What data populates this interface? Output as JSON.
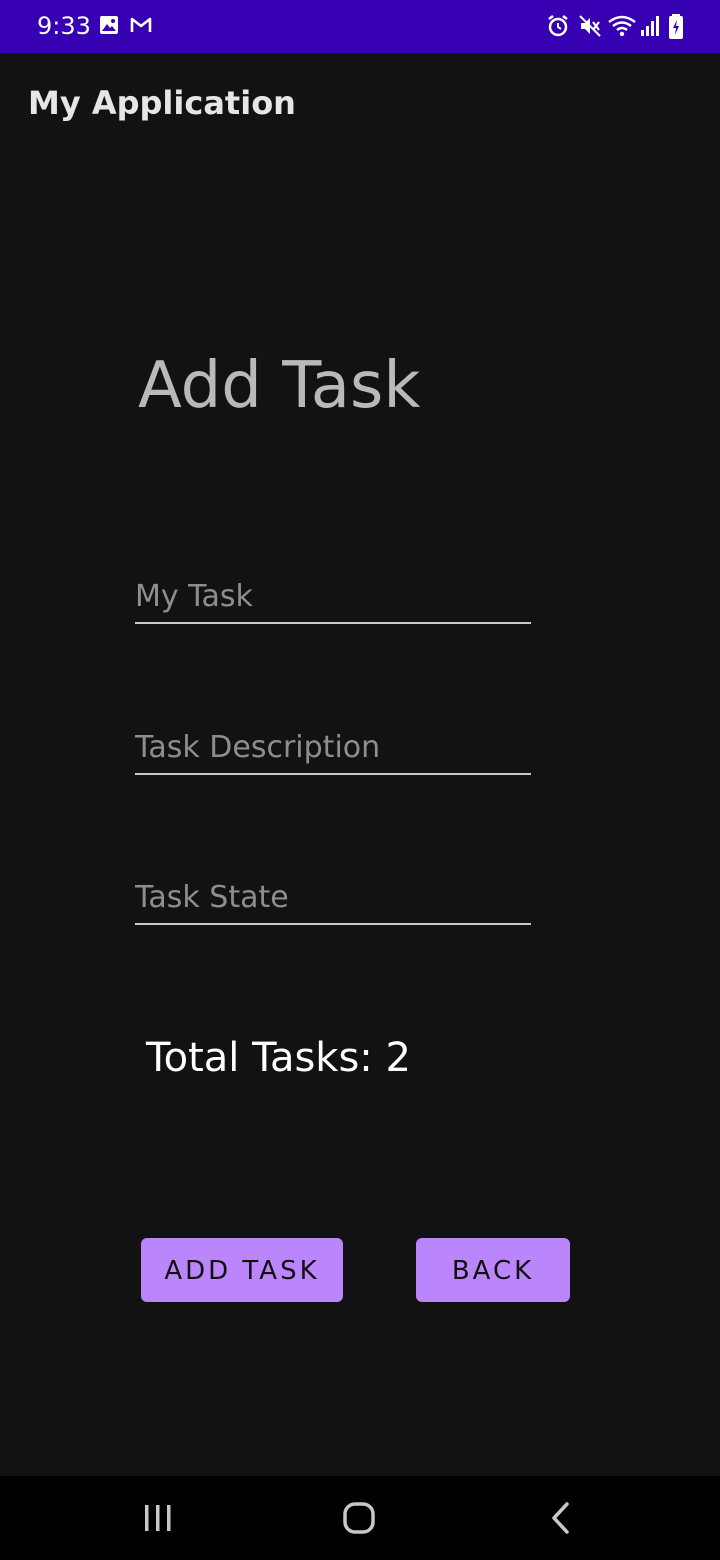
{
  "status_bar": {
    "time": "9:33",
    "left_icons": [
      "gallery-icon",
      "gmail-icon"
    ],
    "right_icons": [
      "alarm-icon",
      "mute-icon",
      "wifi-icon",
      "signal-icon",
      "battery-charging-icon"
    ],
    "background": "#3700b3"
  },
  "app_bar": {
    "title": "My Application"
  },
  "form": {
    "heading": "Add Task",
    "fields": {
      "task": {
        "placeholder": "My Task",
        "value": ""
      },
      "description": {
        "placeholder": "Task Description",
        "value": ""
      },
      "state": {
        "placeholder": "Task State",
        "value": ""
      }
    },
    "total_label": "Total Tasks:",
    "total_count": "2"
  },
  "actions": {
    "add_task": "ADD TASK",
    "back": "BACK",
    "button_color": "#bb86fc"
  },
  "nav_bar": {
    "icons": [
      "recent-apps-icon",
      "home-icon",
      "back-nav-icon"
    ]
  },
  "theme": {
    "background": "#121212"
  }
}
